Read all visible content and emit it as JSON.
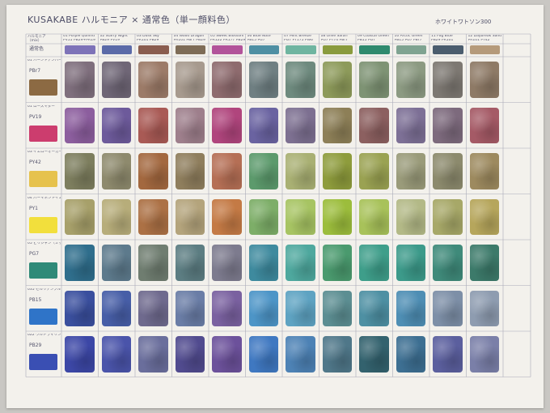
{
  "header": {
    "title_left": "KUSAKABE ハルモニア × 通常色（単一顔料色）",
    "title_right": "ホワイトワトソン300"
  },
  "corner_label": "ハルモニア\n（mix）",
  "base_row_label": "通常色",
  "columns": [
    {
      "label": "01 Purple Quinnd",
      "pigments": "PV55 PB29+PR19"
    },
    {
      "label": "02 Starry Night",
      "pigments": "PB29 PV19"
    },
    {
      "label": "03 Dusk Sky",
      "pigments": "PR101 PB29"
    },
    {
      "label": "04 Wood Dragon",
      "pigments": "PR101 PBr7 PB29"
    },
    {
      "label": "05 Sweet Blossom",
      "pigments": "PR122 PR177 PB29"
    },
    {
      "label": "06 Blue Note",
      "pigments": "PB15 PG7"
    },
    {
      "label": "07 Mint Breeze",
      "pigments": "PG7 PY175 PW6"
    },
    {
      "label": "08 Olive Safari",
      "pigments": "PG7 PY74 PBr7"
    },
    {
      "label": "09 Coastal Green",
      "pigments": "PB15 PG7"
    },
    {
      "label": "10 Arctic Green",
      "pigments": "PB15 PG7 PBr7"
    },
    {
      "label": "11 Fog Blue",
      "pigments": "PB29 PR101"
    },
    {
      "label": "12 Daybreak Sand",
      "pigments": "PR101 PY42"
    }
  ],
  "rows": [
    {
      "label": "01 バーントアンバー",
      "pigment": "PBr7",
      "chip": "#8c6a43",
      "swatches": [
        "#7f6f7d",
        "#6f6676",
        "#9c7b68",
        "#a79a8e",
        "#8e6b6e",
        "#6f7f82",
        "#6e8a7e",
        "#8d9a5a",
        "#7e9374",
        "#8c9a82",
        "#7d7872",
        "#8e7a66"
      ]
    },
    {
      "label": "01 ローズマダー",
      "pigment": "PV19",
      "chip": "#cc3d6e",
      "swatches": [
        "#8c5e9e",
        "#6d5a9b",
        "#a95a55",
        "#9e7f8c",
        "#b0457d",
        "#6a63a1",
        "#7d7091",
        "#8d7f57",
        "#8c6060",
        "#7d7096",
        "#7d6a7d",
        "#a55a66"
      ]
    },
    {
      "label": "03 イエローオーカー",
      "pigment": "PY42",
      "chip": "#e6c24d",
      "swatches": [
        "#7d7e5e",
        "#8e8a6d",
        "#a3683f",
        "#8f7e5d",
        "#b56f55",
        "#5c9a6c",
        "#a9b073",
        "#8e9c3c",
        "#9aa252",
        "#9a9b7a",
        "#8c8a6d",
        "#9d8a5f"
      ]
    },
    {
      "label": "04 パーマネントイエローライト",
      "pigment": "PY1",
      "chip": "#f2df3c",
      "swatches": [
        "#a7a06a",
        "#b7ad7a",
        "#ac7145",
        "#b4a47c",
        "#c47a45",
        "#7dae68",
        "#a7c463",
        "#9cbd3c",
        "#a8c25a",
        "#b3b987",
        "#a7a868",
        "#b6a65c"
      ]
    },
    {
      "label": "05 ビリジャン（ミックス）",
      "pigment": "PG7",
      "chip": "#2f8a78",
      "swatches": [
        "#2f6e8c",
        "#5d7a8c",
        "#6f7d70",
        "#5c7d82",
        "#7d7b8e",
        "#3e8a9e",
        "#4ea89e",
        "#4a9a6e",
        "#3e9e8a",
        "#3c9a8a",
        "#3f8a7a",
        "#3c7a6a"
      ]
    },
    {
      "label": "035 セルリアンブルー",
      "pigment": "PB15",
      "chip": "#2f74c8",
      "swatches": [
        "#3a4f9e",
        "#475ea7",
        "#6f6a8e",
        "#6a7da6",
        "#7a61a0",
        "#4d95c7",
        "#5ea3c2",
        "#5c8e92",
        "#4e90a3",
        "#4e8eb4",
        "#7d8fa7",
        "#8e9cb0"
      ]
    },
    {
      "label": "022 ウルトラマリンブルー",
      "pigment": "PB29",
      "chip": "#3a4fb3",
      "swatches": [
        "#3c47a6",
        "#4a54aa",
        "#6a6e9c",
        "#514b8f",
        "#6c519b",
        "#3f78c1",
        "#4d82b5",
        "#4f7789",
        "#33626e",
        "#3d6f92",
        "#5b5f9e",
        "#7a7fa8"
      ]
    }
  ]
}
